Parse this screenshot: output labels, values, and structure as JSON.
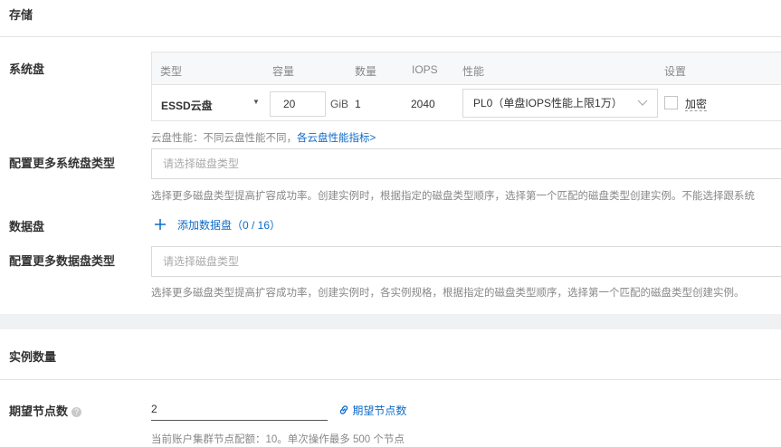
{
  "storage": {
    "title": "存储",
    "system_disk": {
      "label": "系统盘",
      "headers": {
        "type": "类型",
        "capacity": "容量",
        "count": "数量",
        "iops": "IOPS",
        "performance": "性能",
        "settings": "设置"
      },
      "type": "ESSD云盘",
      "capacity": "20",
      "unit": "GiB",
      "count": "1",
      "iops": "2040",
      "performance": "PL0（单盘IOPS性能上限1万）",
      "encrypt_label": "加密",
      "encrypt_checked": false,
      "hint_prefix": "云盘性能：不同云盘性能不同，",
      "hint_link": "各云盘性能指标>"
    },
    "more_system_types": {
      "label": "配置更多系统盘类型",
      "placeholder": "请选择磁盘类型",
      "hint": "选择更多磁盘类型提高扩容成功率。创建实例时，根据指定的磁盘类型顺序，选择第一个匹配的磁盘类型创建实例。不能选择跟系统"
    },
    "data_disk": {
      "label": "数据盘",
      "add_label": "添加数据盘（0 / 16）"
    },
    "more_data_types": {
      "label": "配置更多数据盘类型",
      "placeholder": "请选择磁盘类型",
      "hint": "选择更多磁盘类型提高扩容成功率，创建实例时，各实例规格，根据指定的磁盘类型顺序，选择第一个匹配的磁盘类型创建实例。"
    }
  },
  "instance_count": {
    "title": "实例数量",
    "expected_nodes": {
      "label": "期望节点数",
      "value": "2",
      "link": "期望节点数",
      "hint": "当前账户集群节点配额：10。单次操作最多 500 个节点"
    }
  },
  "colors": {
    "link": "#0f6bc8",
    "background": "#f0f1f3"
  },
  "icons": {
    "help": "question-circle-icon",
    "add": "plus-icon",
    "link": "link-icon",
    "caret": "caret-down-icon",
    "chevron": "chevron-down-icon"
  }
}
